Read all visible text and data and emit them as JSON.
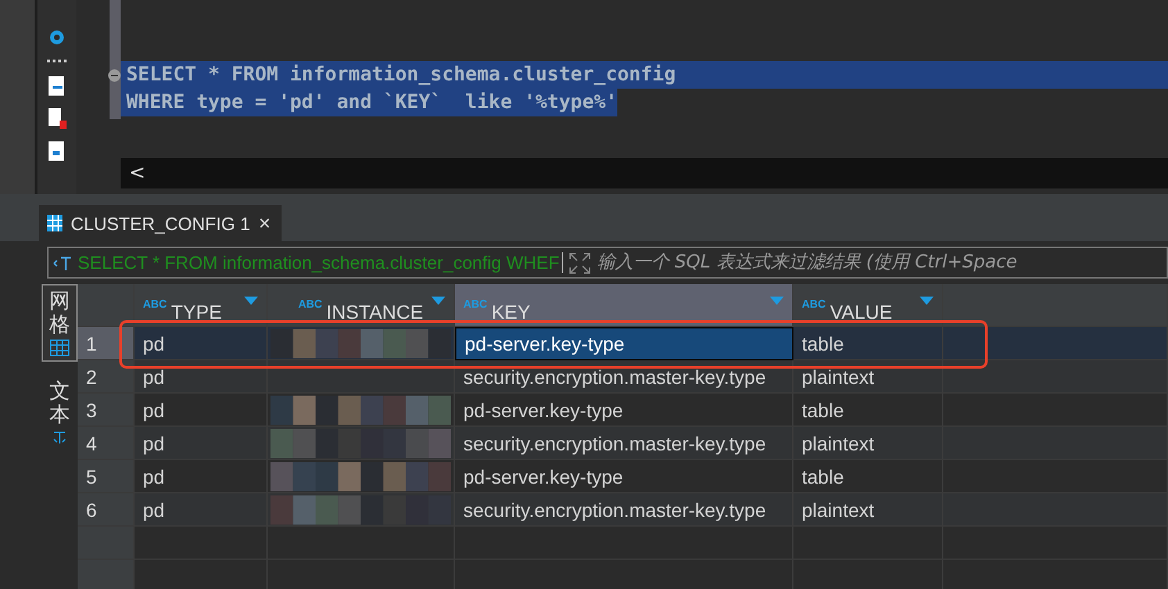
{
  "editor": {
    "lines": [
      {
        "text": "SELECT * FROM information_schema.cluster_config",
        "selected": true,
        "fold": true
      },
      {
        "text": "WHERE type = 'pd' and `KEY`  like '%type%'",
        "selected": true,
        "fold": false
      }
    ],
    "scroll_left": "<"
  },
  "result_tab": {
    "label": "CLUSTER_CONFIG 1",
    "close": "×"
  },
  "filter": {
    "query": "SELECT * FROM information_schema.cluster_config WHEF",
    "placeholder": "输入一个 SQL 表达式来过滤结果 (使用 Ctrl+Space"
  },
  "side_tabs": [
    {
      "label": "网格",
      "selected": true
    },
    {
      "label": "文本",
      "selected": false
    }
  ],
  "table": {
    "columns": [
      {
        "type_tag": "ABC",
        "label": "TYPE",
        "selected": false
      },
      {
        "type_tag": "ABC",
        "label": "INSTANCE",
        "selected": false
      },
      {
        "type_tag": "ABC",
        "label": "KEY",
        "selected": true
      },
      {
        "type_tag": "ABC",
        "label": "VALUE",
        "selected": false
      }
    ],
    "rows": [
      {
        "num": "1",
        "selected": true,
        "type": "pd",
        "key": "pd-server.key-type",
        "value": "table"
      },
      {
        "num": "2",
        "selected": false,
        "type": "pd",
        "key": "security.encryption.master-key.type",
        "value": "plaintext"
      },
      {
        "num": "3",
        "selected": false,
        "type": "pd",
        "key": "pd-server.key-type",
        "value": "table"
      },
      {
        "num": "4",
        "selected": false,
        "type": "pd",
        "key": "security.encryption.master-key.type",
        "value": "plaintext"
      },
      {
        "num": "5",
        "selected": false,
        "type": "pd",
        "key": "pd-server.key-type",
        "value": "table"
      },
      {
        "num": "6",
        "selected": false,
        "type": "pd",
        "key": "security.encryption.master-key.type",
        "value": "plaintext"
      }
    ]
  }
}
